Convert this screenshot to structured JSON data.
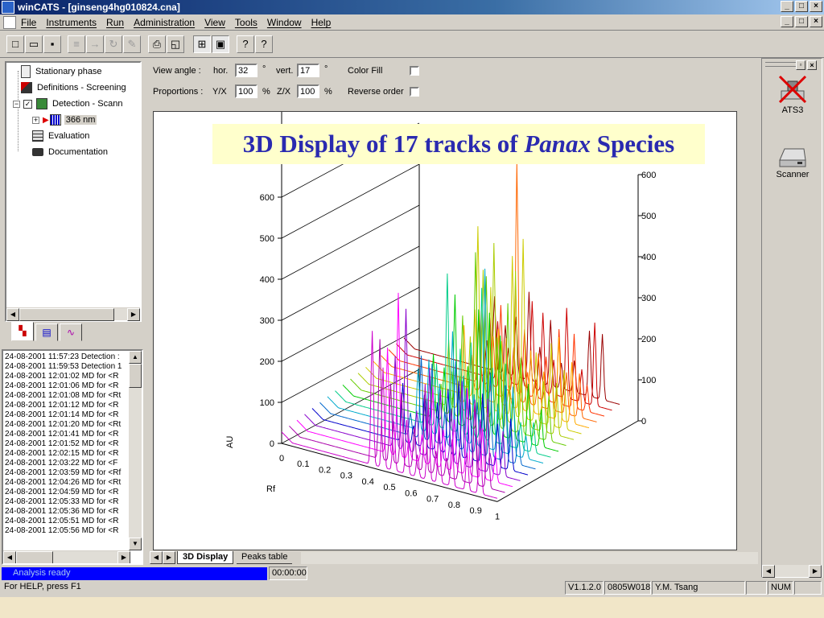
{
  "window": {
    "title": "winCATS - [ginseng4hg010824.cna]",
    "buttons": [
      "_",
      "□",
      "×"
    ]
  },
  "menu": {
    "items": [
      "File",
      "Instruments",
      "Run",
      "Administration",
      "View",
      "Tools",
      "Window",
      "Help"
    ]
  },
  "tree": {
    "items": [
      {
        "label": "Stationary phase"
      },
      {
        "label": "Definitions - Screening"
      },
      {
        "label": "Detection - Scann"
      },
      {
        "label": "366 nm"
      },
      {
        "label": "Evaluation"
      },
      {
        "label": "Documentation"
      }
    ]
  },
  "log": {
    "lines": [
      "24-08-2001 11:57:23 Detection :",
      "24-08-2001 11:59:53 Detection 1",
      "24-08-2001 12:01:02 MD for <R",
      "24-08-2001 12:01:06 MD for <R",
      "24-08-2001 12:01:08 MD for <Rt",
      "24-08-2001 12:01:12 MD for <R",
      "24-08-2001 12:01:14 MD for <R",
      "24-08-2001 12:01:20 MD for <Rt",
      "24-08-2001 12:01:41 MD for <R",
      "24-08-2001 12:01:52 MD for <R",
      "24-08-2001 12:02:15 MD for <R",
      "24-08-2001 12:03:22 MD for <F",
      "24-08-2001 12:03:59 MD for <Rf",
      "24-08-2001 12:04:26 MD for <Rt",
      "24-08-2001 12:04:59 MD for <R",
      "24-08-2001 12:05:33 MD for <R",
      "24-08-2001 12:05:36 MD for <R",
      "24-08-2001 12:05:51 MD for <R",
      "24-08-2001 12:05:56 MD for <R"
    ]
  },
  "controls": {
    "view_angle_label": "View angle :",
    "hor_label": "hor.",
    "hor_value": "32",
    "deg1": "°",
    "vert_label": "vert.",
    "vert_value": "17",
    "deg2": "°",
    "color_fill_label": "Color Fill",
    "proportions_label": "Proportions :",
    "yx_label": "Y/X",
    "yx_value": "100",
    "pct1": "%",
    "zx_label": "Z/X",
    "zx_value": "100",
    "pct2": "%",
    "reverse_label": "Reverse order"
  },
  "banner": {
    "part1": "3D Display of 17 tracks of ",
    "italic": "Panax",
    "part2": " Species"
  },
  "chart_data": {
    "type": "line",
    "title": "3D Display of 17 tracks of Panax Species",
    "xlabel": "Rf",
    "ylabel": "AU",
    "x_ticks": [
      "0",
      "0.1",
      "0.2",
      "0.3",
      "0.4",
      "0.5",
      "0.6",
      "0.7",
      "0.8",
      "0.9",
      "1"
    ],
    "y_ticks_left": [
      "0",
      "100",
      "200",
      "300",
      "400",
      "500",
      "600"
    ],
    "y_ticks_right": [
      "0",
      "100",
      "200",
      "300",
      "400",
      "500",
      "600"
    ],
    "ylim": [
      0,
      600
    ],
    "tracks": 17,
    "colors": [
      "#cc00cc",
      "#aa00aa",
      "#ff00ff",
      "#8800cc",
      "#0000cc",
      "#0066cc",
      "#00aacc",
      "#00cc88",
      "#00cc00",
      "#66cc00",
      "#aacc00",
      "#cccc00",
      "#ffaa00",
      "#ff6600",
      "#ff3300",
      "#cc0000",
      "#990000"
    ]
  },
  "bottom_tabs": [
    "3D Display",
    "Peaks table"
  ],
  "devices": [
    {
      "label": "ATS3"
    },
    {
      "label": "Scanner"
    }
  ],
  "status": {
    "analysis": "Analysis ready",
    "time": "00:00:00",
    "help": "For HELP, press F1",
    "version": "V1.1.2.0",
    "code": "0805W018",
    "user": "Y.M. Tsang",
    "num": "NUM"
  }
}
